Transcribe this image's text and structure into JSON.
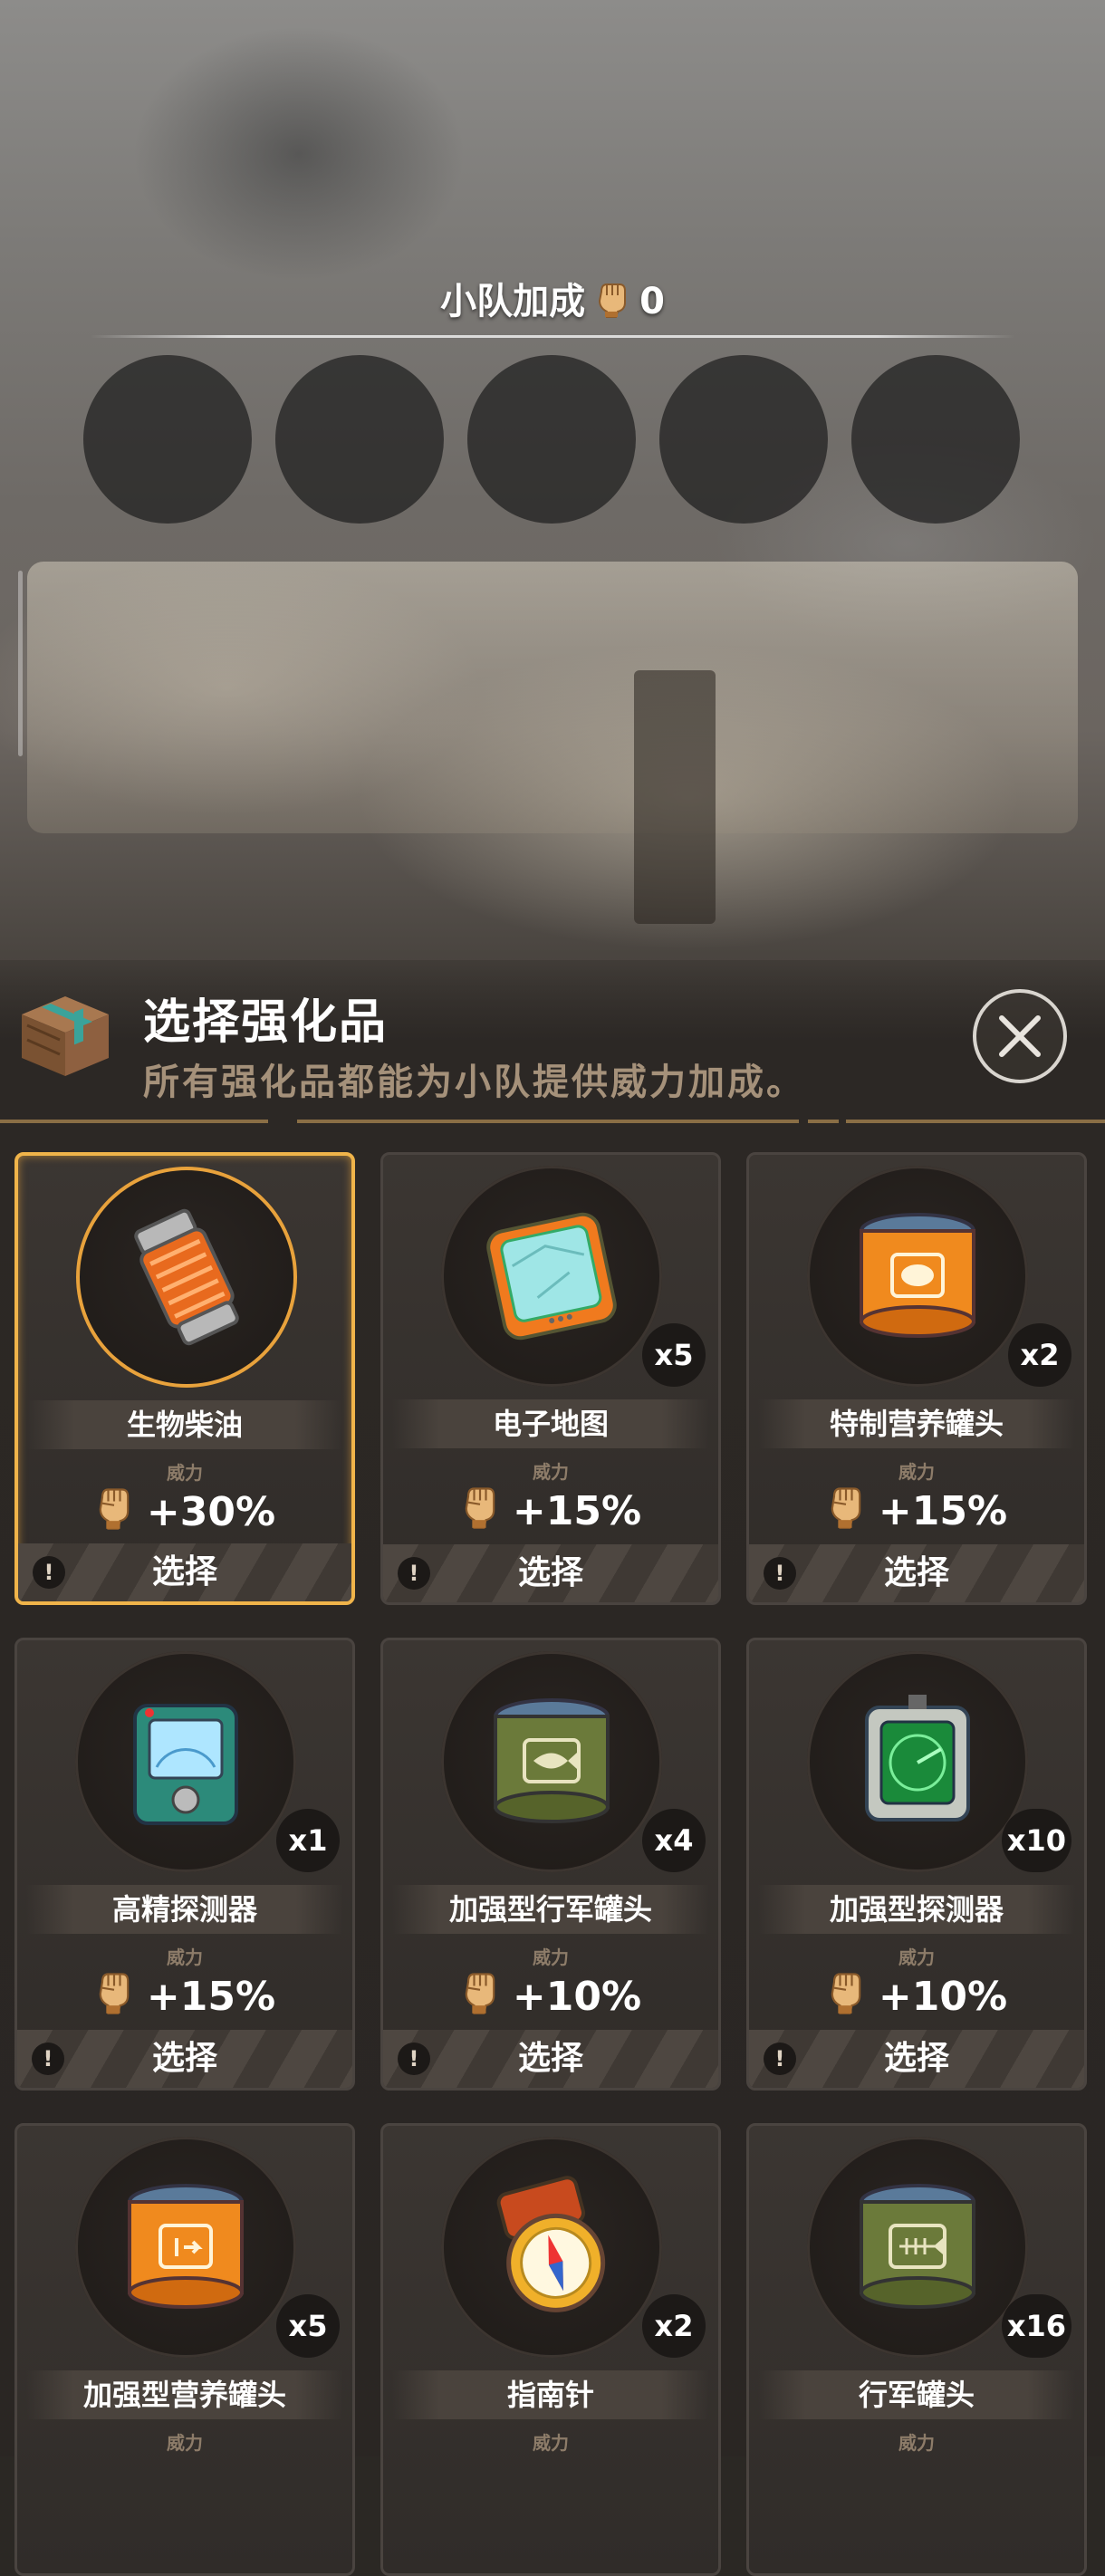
{
  "squad": {
    "title": "小队加成",
    "value": "0",
    "slots": 5
  },
  "panel": {
    "title": "选择强化品",
    "subtitle": "所有强化品都能为小队提供威力加成。",
    "close_icon": "close-icon"
  },
  "colors": {
    "accent": "#f0b44a",
    "subtitle": "#a5917a",
    "card_bg": "#302c29"
  },
  "items": [
    {
      "name": "生物柴油",
      "count": "",
      "power_label": "威力",
      "power": "+30%",
      "action": "选择",
      "icon": "fuel-canister-icon",
      "selected": true
    },
    {
      "name": "电子地图",
      "count": "x5",
      "power_label": "威力",
      "power": "+15%",
      "action": "选择",
      "icon": "tablet-map-icon",
      "selected": false
    },
    {
      "name": "特制营养罐头",
      "count": "x2",
      "power_label": "威力",
      "power": "+15%",
      "action": "选择",
      "icon": "orange-can-meat-icon",
      "selected": false
    },
    {
      "name": "高精探测器",
      "count": "x1",
      "power_label": "威力",
      "power": "+15%",
      "action": "选择",
      "icon": "radar-detector-icon",
      "selected": false
    },
    {
      "name": "加强型行军罐头",
      "count": "x4",
      "power_label": "威力",
      "power": "+10%",
      "action": "选择",
      "icon": "green-can-fish-icon",
      "selected": false
    },
    {
      "name": "加强型探测器",
      "count": "x10",
      "power_label": "威力",
      "power": "+10%",
      "action": "选择",
      "icon": "green-radar-icon",
      "selected": false
    },
    {
      "name": "加强型营养罐头",
      "count": "x5",
      "power_label": "威力",
      "power": "",
      "action": "",
      "icon": "orange-can-icon",
      "selected": false
    },
    {
      "name": "指南针",
      "count": "x2",
      "power_label": "威力",
      "power": "",
      "action": "",
      "icon": "compass-icon",
      "selected": false
    },
    {
      "name": "行军罐头",
      "count": "x16",
      "power_label": "威力",
      "power": "",
      "action": "",
      "icon": "green-can-bone-icon",
      "selected": false
    }
  ]
}
